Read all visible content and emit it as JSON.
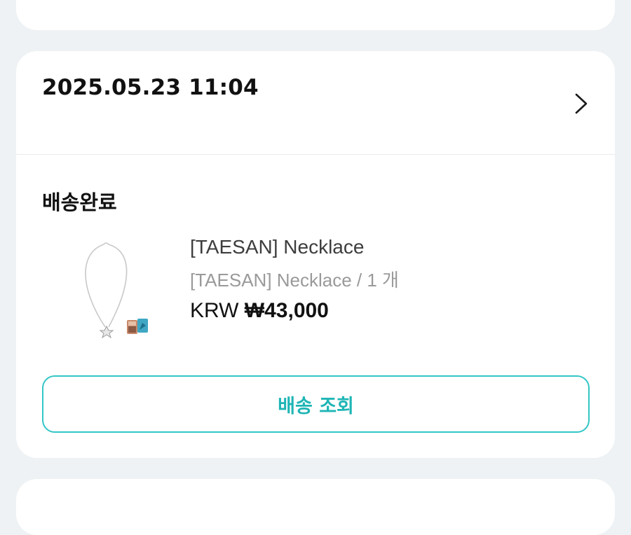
{
  "order": {
    "date": "2025.05.23 11:04",
    "status": "배송완료",
    "item": {
      "title": "[TAESAN] Necklace",
      "option": "[TAESAN] Necklace / 1 개",
      "price_currency": "KRW",
      "price_amount": "₩43,000",
      "image_icon": "necklace-product-image"
    },
    "track_button_label": "배송 조회",
    "open_icon": "chevron-right-icon"
  },
  "colors": {
    "background": "#eef2f4",
    "card": "#ffffff",
    "accent": "#1fb5b5",
    "accent_border": "#33c6c6",
    "text_primary": "#111111",
    "text_secondary": "#3d3d3d",
    "text_muted": "#9a9a9a"
  }
}
